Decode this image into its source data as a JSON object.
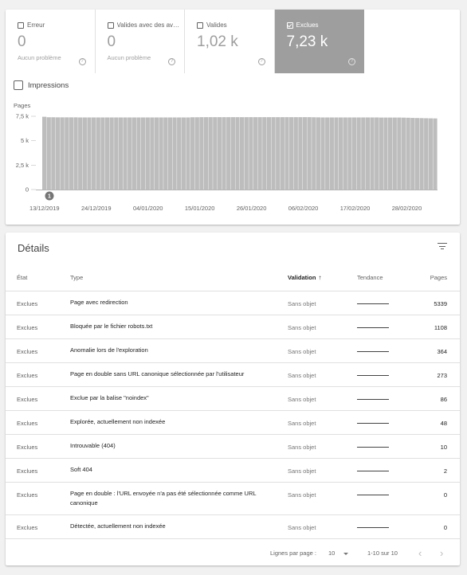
{
  "summary": {
    "tiles": [
      {
        "label": "Erreur",
        "value": "0",
        "sub": "Aucun problème",
        "active": false
      },
      {
        "label": "Valides avec des avertissements",
        "value": "0",
        "sub": "Aucun problème",
        "active": false
      },
      {
        "label": "Valides",
        "value": "1,02 k",
        "sub": "",
        "active": false
      },
      {
        "label": "Exclues",
        "value": "7,23 k",
        "sub": "",
        "active": true
      }
    ],
    "help_glyph": "?"
  },
  "impressions_label": "Impressions",
  "chart_data": {
    "type": "bar",
    "ylabel": "Pages",
    "yticks": [
      "0",
      "2,5 k",
      "5 k",
      "7,5 k"
    ],
    "ylim": [
      0,
      7500
    ],
    "xticks": [
      "13/12/2019",
      "24/12/2019",
      "04/01/2020",
      "15/01/2020",
      "26/01/2020",
      "06/02/2020",
      "17/02/2020",
      "28/02/2020"
    ],
    "x_start": "2019-12-13",
    "x_end": "2020-03-06",
    "values": [
      7450,
      7400,
      7400,
      7390,
      7390,
      7390,
      7390,
      7390,
      7380,
      7380,
      7380,
      7380,
      7380,
      7380,
      7380,
      7380,
      7380,
      7380,
      7380,
      7380,
      7380,
      7380,
      7380,
      7380,
      7380,
      7380,
      7380,
      7380,
      7380,
      7380,
      7380,
      7380,
      7380,
      7400,
      7400,
      7410,
      7410,
      7410,
      7410,
      7410,
      7410,
      7410,
      7410,
      7410,
      7410,
      7410,
      7410,
      7410,
      7410,
      7410,
      7410,
      7410,
      7410,
      7410,
      7410,
      7410,
      7410,
      7410,
      7410,
      7410,
      7400,
      7390,
      7380,
      7380,
      7380,
      7380,
      7380,
      7380,
      7380,
      7380,
      7380,
      7380,
      7380,
      7380,
      7380,
      7370,
      7370,
      7370,
      7370,
      7370,
      7360,
      7350,
      7330,
      7320,
      7310,
      7300,
      7290,
      7280
    ],
    "annotation": "1",
    "bar_color": "#bdbdbd"
  },
  "details": {
    "title": "Détails",
    "columns": {
      "etat": "État",
      "type": "Type",
      "validation": "Validation",
      "tendance": "Tendance",
      "pages": "Pages"
    },
    "sort_arrow": "↑",
    "rows": [
      {
        "etat": "Exclues",
        "type": "Page avec redirection",
        "validation": "Sans objet",
        "pages": "5339"
      },
      {
        "etat": "Exclues",
        "type": "Bloquée par le fichier robots.txt",
        "validation": "Sans objet",
        "pages": "1108"
      },
      {
        "etat": "Exclues",
        "type": "Anomalie lors de l'exploration",
        "validation": "Sans objet",
        "pages": "364"
      },
      {
        "etat": "Exclues",
        "type": "Page en double sans URL canonique sélectionnée par l'utilisateur",
        "validation": "Sans objet",
        "pages": "273"
      },
      {
        "etat": "Exclues",
        "type": "Exclue par la balise \"noindex\"",
        "validation": "Sans objet",
        "pages": "86"
      },
      {
        "etat": "Exclues",
        "type": "Explorée, actuellement non indexée",
        "validation": "Sans objet",
        "pages": "48"
      },
      {
        "etat": "Exclues",
        "type": "Introuvable (404)",
        "validation": "Sans objet",
        "pages": "10"
      },
      {
        "etat": "Exclues",
        "type": "Soft 404",
        "validation": "Sans objet",
        "pages": "2"
      },
      {
        "etat": "Exclues",
        "type": "Page en double : l'URL envoyée n'a pas été sélectionnée comme URL canonique",
        "validation": "Sans objet",
        "pages": "0"
      },
      {
        "etat": "Exclues",
        "type": "Détectée, actuellement non indexée",
        "validation": "Sans objet",
        "pages": "0"
      }
    ],
    "footer": {
      "rows_per_page_label": "Lignes par page :",
      "rows_per_page_value": "10",
      "range": "1-10 sur 10",
      "prev": "‹",
      "next": "›"
    }
  }
}
